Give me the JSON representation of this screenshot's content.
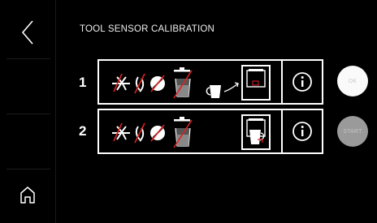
{
  "screen": {
    "title": "TOOL SENSOR CALIBRATION"
  },
  "sidebar": {
    "back_icon": "chevron-left-icon",
    "home_icon": "home-icon"
  },
  "rows": [
    {
      "number": "1",
      "button_label": "OK"
    },
    {
      "number": "2",
      "button_label": "START"
    }
  ],
  "colors": {
    "background": "#000000",
    "foreground": "#ffffff",
    "prohibited": "#e02020"
  }
}
